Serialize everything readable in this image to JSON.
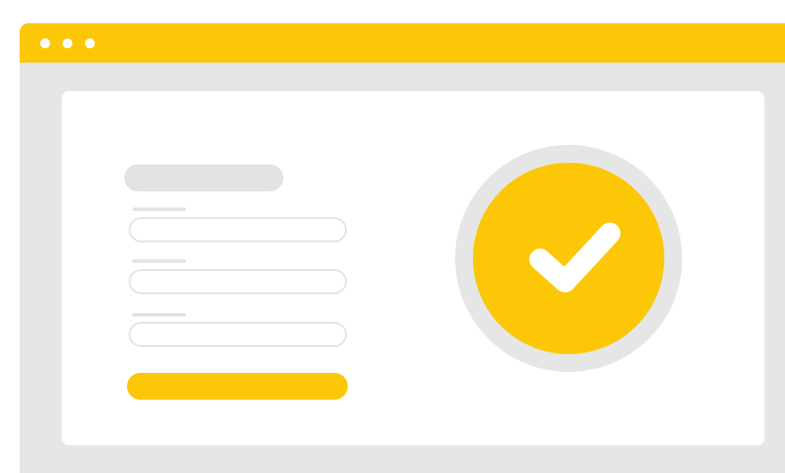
{
  "window": {
    "title_bar_color": "#fbc707",
    "background_color": "#e6e6e6",
    "dot_count": 3
  },
  "content_panel": {
    "background_color": "#ffffff"
  },
  "form": {
    "heading": "",
    "fields": [
      {
        "label": "",
        "value": "",
        "placeholder": ""
      },
      {
        "label": "",
        "value": "",
        "placeholder": ""
      },
      {
        "label": "",
        "value": "",
        "placeholder": ""
      }
    ],
    "submit_label": ""
  },
  "success_indicator": {
    "icon": "check-icon",
    "circle_color": "#fbc707",
    "ring_color": "#e6e6e6",
    "check_color": "#ffffff"
  }
}
